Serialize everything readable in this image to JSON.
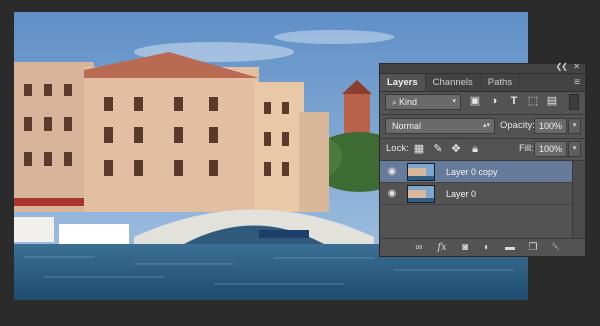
{
  "panel": {
    "tabs": [
      {
        "label": "Layers",
        "active": true
      },
      {
        "label": "Channels",
        "active": false
      },
      {
        "label": "Paths",
        "active": false
      }
    ],
    "filter": {
      "label": "Kind"
    },
    "blend_mode": {
      "value": "Normal"
    },
    "opacity": {
      "label": "Opacity:",
      "value": "100%"
    },
    "lock": {
      "label": "Lock:"
    },
    "fill": {
      "label": "Fill:",
      "value": "100%"
    },
    "layers": [
      {
        "name": "Layer 0 copy",
        "selected": true,
        "visible": true
      },
      {
        "name": "Layer 0",
        "selected": false,
        "visible": true
      }
    ],
    "icons": {
      "collapse": "double-chevron-icon",
      "close": "close-icon",
      "menu": "panel-menu-icon",
      "search": "search-icon",
      "filter_image": "image-filter-icon",
      "filter_adjust": "adjustment-filter-icon",
      "filter_text": "text-filter-icon",
      "filter_shape": "shape-filter-icon",
      "filter_smart": "smart-object-filter-icon",
      "lock_transparent": "lock-transparent-icon",
      "lock_paint": "brush-icon",
      "lock_move": "move-icon",
      "lock_all": "lock-icon",
      "link": "link-icon",
      "fx": "fx-icon",
      "mask": "mask-icon",
      "adjust": "half-circle-icon",
      "folder": "folder-icon",
      "new": "new-layer-icon",
      "trash": "trash-icon"
    },
    "colors": {
      "panel_bg": "#535353",
      "selection": "#667a99",
      "canvas_bg": "#2b2b2b"
    }
  }
}
